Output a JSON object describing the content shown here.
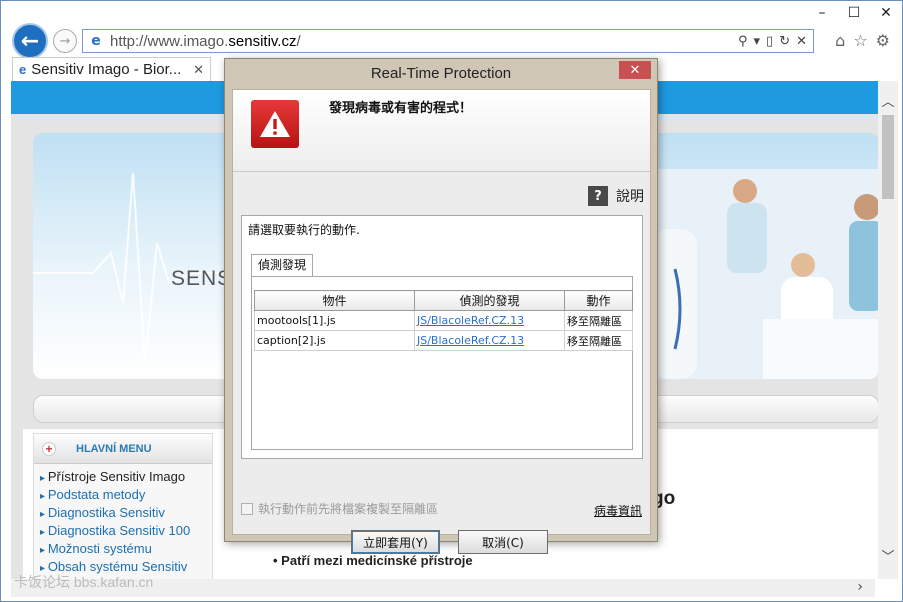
{
  "browser": {
    "url_prefix": "http://www.imago.",
    "url_domain": "sensitiv.cz",
    "url_suffix": "/",
    "tab_title": "Sensitiv Imago - Bior...",
    "controls": {
      "minimize": "–",
      "maximize": "☐",
      "close": "✕"
    }
  },
  "page": {
    "brand_text": "SENS",
    "menu": {
      "header": "HLAVNÍ MENU",
      "items": [
        "Přístroje Sensitiv Imago",
        "Podstata metody",
        "Diagnostika Sensitiv",
        "Diagnostika Sensitiv 100",
        "Možnosti systému",
        "Obsah systému Sensitiv"
      ]
    },
    "heading_fragment": "go",
    "bullet_text": "Patří mezi medicínské přístroje",
    "watermark": "卡饭论坛 bbs.kafan.cn",
    "colors": {
      "header_band": "#1e9ae0",
      "menu_link": "#1c6fb0"
    }
  },
  "dialog": {
    "title": "Real-Time Protection",
    "heading": "發現病毒或有害的程式！",
    "help_label": "說明",
    "prompt": "請選取要執行的動作.",
    "tab_label": "偵測發現",
    "columns": [
      "物件",
      "偵測的發現",
      "動作"
    ],
    "rows": [
      {
        "object": "mootools[1].js",
        "detection": "JS/BlacoleRef.CZ.13",
        "action": "移至隔離區"
      },
      {
        "object": "caption[2].js",
        "detection": "JS/BlacoleRef.CZ.13",
        "action": "移至隔離區"
      }
    ],
    "copy_option": "執行動作前先將檔案複製至隔離區",
    "virus_info_link": "病毒資訊",
    "apply_button": "立即套用(Y)",
    "cancel_button": "取消(C)",
    "colors": {
      "warning": "#d42020",
      "link": "#2b6fd0"
    }
  }
}
